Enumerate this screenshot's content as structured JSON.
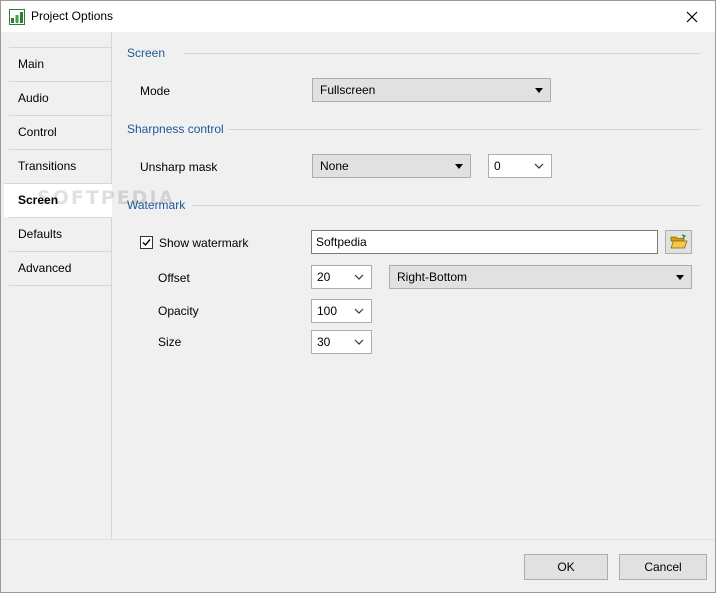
{
  "window": {
    "title": "Project Options"
  },
  "sidebar": {
    "items": [
      {
        "label": "Main"
      },
      {
        "label": "Audio"
      },
      {
        "label": "Control"
      },
      {
        "label": "Transitions"
      },
      {
        "label": "Screen"
      },
      {
        "label": "Defaults"
      },
      {
        "label": "Advanced"
      }
    ],
    "active": "Screen"
  },
  "screen_group": {
    "title": "Screen",
    "mode_label": "Mode",
    "mode_value": "Fullscreen"
  },
  "sharpness_group": {
    "title": "Sharpness control",
    "unsharp_label": "Unsharp mask",
    "unsharp_value": "None",
    "amount_value": "0"
  },
  "watermark_group": {
    "title": "Watermark",
    "show_label": "Show watermark",
    "show_checked": true,
    "text_value": "Softpedia",
    "offset_label": "Offset",
    "offset_value": "20",
    "position_value": "Right-Bottom",
    "opacity_label": "Opacity",
    "opacity_value": "100",
    "size_label": "Size",
    "size_value": "30"
  },
  "footer": {
    "ok_label": "OK",
    "cancel_label": "Cancel"
  },
  "overlay": {
    "text": "SOFTPEDIA"
  },
  "colors": {
    "group_header": "#1e5799",
    "background": "#f0f0f0",
    "active_tab": "#ffffff"
  }
}
